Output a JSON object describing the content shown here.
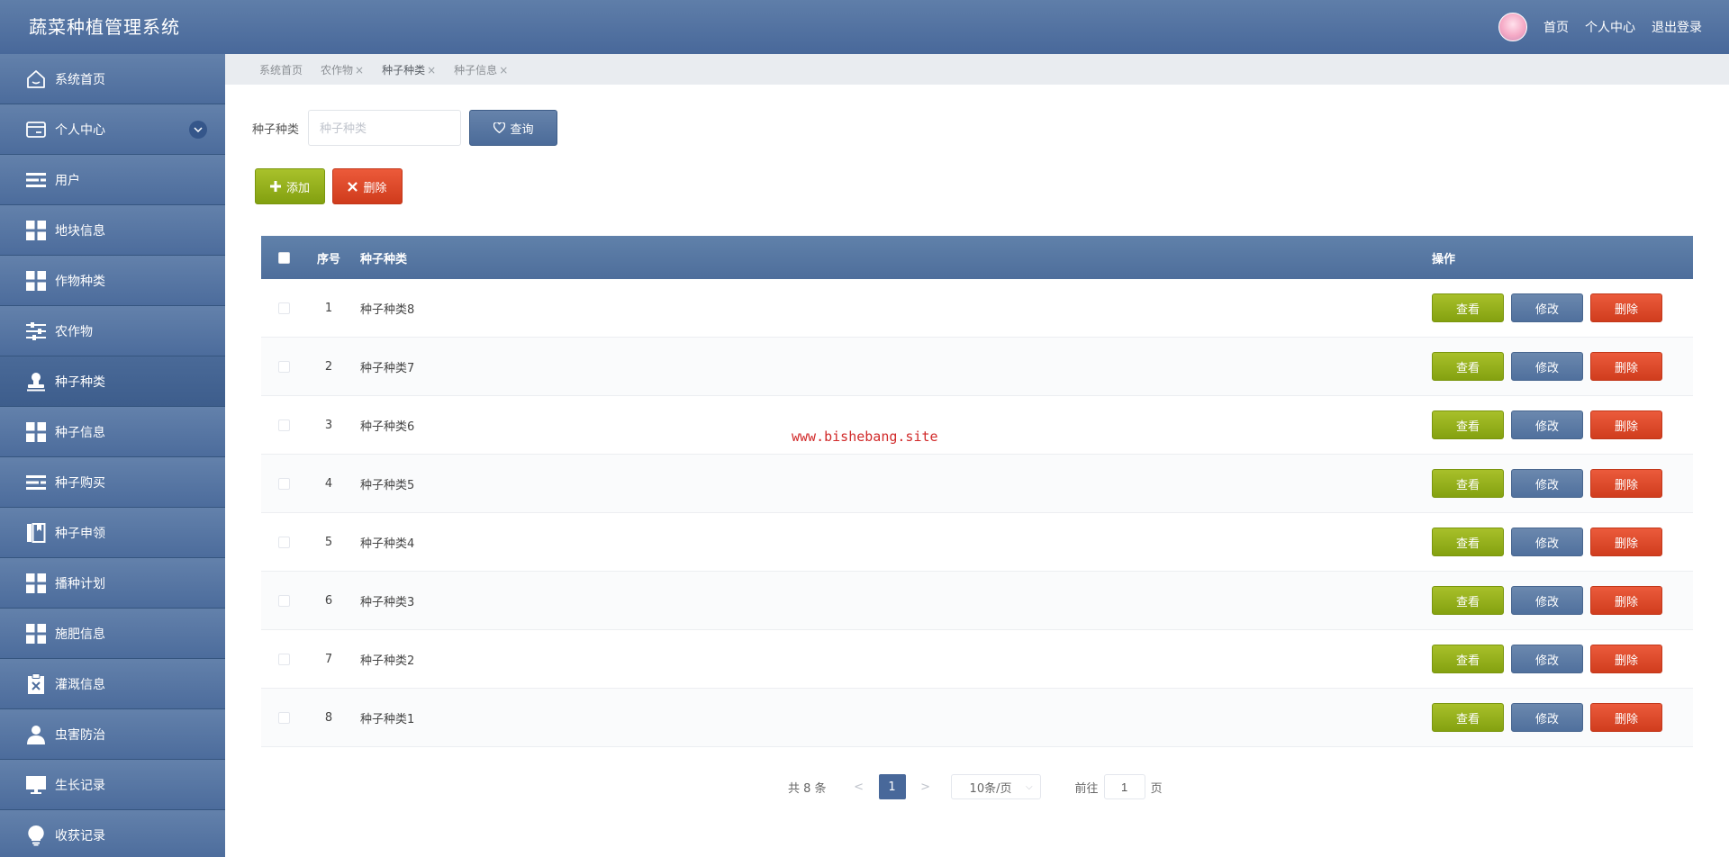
{
  "app": {
    "title": "蔬菜种植管理系统"
  },
  "header": {
    "links": [
      "首页",
      "个人中心",
      "退出登录"
    ]
  },
  "sidebar": {
    "items": [
      {
        "label": "系统首页",
        "icon": "home-icon"
      },
      {
        "label": "个人中心",
        "icon": "card-icon",
        "expandable": true
      },
      {
        "label": "用户",
        "icon": "list-icon"
      },
      {
        "label": "地块信息",
        "icon": "grid-icon"
      },
      {
        "label": "作物种类",
        "icon": "grid-icon"
      },
      {
        "label": "农作物",
        "icon": "sliders-icon"
      },
      {
        "label": "种子种类",
        "icon": "stamp-icon",
        "active": true
      },
      {
        "label": "种子信息",
        "icon": "grid-icon"
      },
      {
        "label": "种子购买",
        "icon": "list-icon"
      },
      {
        "label": "种子申领",
        "icon": "book-icon"
      },
      {
        "label": "播种计划",
        "icon": "grid-icon"
      },
      {
        "label": "施肥信息",
        "icon": "grid-icon"
      },
      {
        "label": "灌溉信息",
        "icon": "clipboard-icon"
      },
      {
        "label": "虫害防治",
        "icon": "person-icon"
      },
      {
        "label": "生长记录",
        "icon": "monitor-icon"
      },
      {
        "label": "收获记录",
        "icon": "bulb-icon"
      }
    ]
  },
  "tags": [
    {
      "label": "系统首页",
      "closable": false
    },
    {
      "label": "农作物",
      "closable": true
    },
    {
      "label": "种子种类",
      "closable": true,
      "current": true
    },
    {
      "label": "种子信息",
      "closable": true
    }
  ],
  "search": {
    "label": "种子种类",
    "placeholder": "种子种类",
    "button": "查询"
  },
  "actions": {
    "add": "添加",
    "delete": "删除"
  },
  "table": {
    "headers": {
      "index": "序号",
      "name": "种子种类",
      "ops": "操作"
    },
    "rows": [
      {
        "index": "1",
        "name": "种子种类8"
      },
      {
        "index": "2",
        "name": "种子种类7"
      },
      {
        "index": "3",
        "name": "种子种类6"
      },
      {
        "index": "4",
        "name": "种子种类5"
      },
      {
        "index": "5",
        "name": "种子种类4"
      },
      {
        "index": "6",
        "name": "种子种类3"
      },
      {
        "index": "7",
        "name": "种子种类2"
      },
      {
        "index": "8",
        "name": "种子种类1"
      }
    ],
    "ops": {
      "view": "查看",
      "edit": "修改",
      "delete": "删除"
    }
  },
  "watermark": "www.bishebang.site",
  "pagination": {
    "total": "共 8 条",
    "prev": "<",
    "page": "1",
    "next": ">",
    "page_size": "10条/页",
    "goto_label": "前往",
    "goto_value": "1",
    "goto_suffix": "页"
  },
  "colors": {
    "primary": "#48689a",
    "view": "#84a110",
    "delete": "#d03d1e"
  }
}
